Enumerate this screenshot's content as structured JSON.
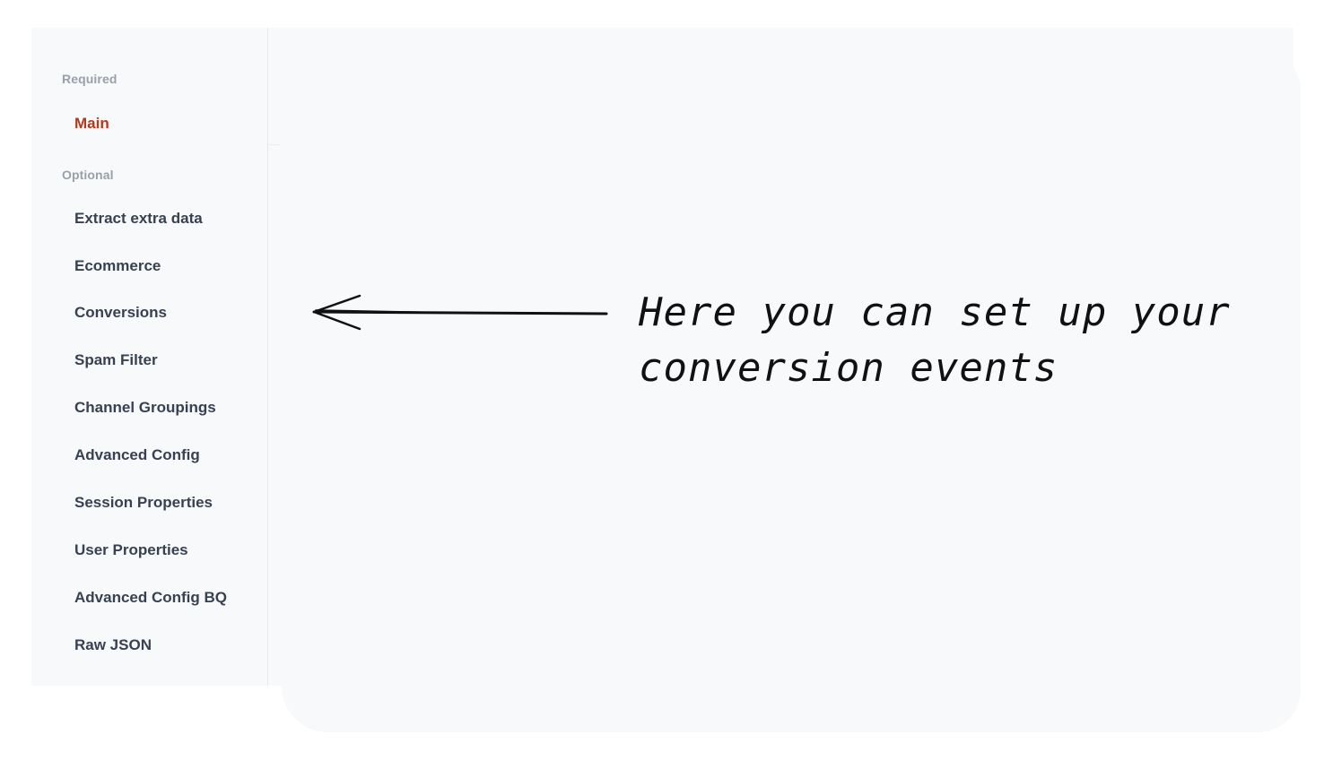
{
  "sidebar": {
    "required_label": "Required",
    "optional_label": "Optional",
    "items": [
      {
        "label": "Main"
      },
      {
        "label": "Extract extra data"
      },
      {
        "label": "Ecommerce"
      },
      {
        "label": "Conversions"
      },
      {
        "label": "Spam Filter"
      },
      {
        "label": "Channel Groupings"
      },
      {
        "label": "Advanced Config"
      },
      {
        "label": "Session Properties"
      },
      {
        "label": "User Properties"
      },
      {
        "label": "Advanced Config BQ"
      },
      {
        "label": "Raw JSON"
      }
    ]
  },
  "annotation": {
    "line1": "Here you can set up your",
    "line2": "conversion events",
    "arrow_icon": "left-arrow-icon"
  },
  "colors": {
    "active": "#b0391f",
    "text": "#374151",
    "muted": "#9aa0a8",
    "panel": "#f8f9fb"
  }
}
